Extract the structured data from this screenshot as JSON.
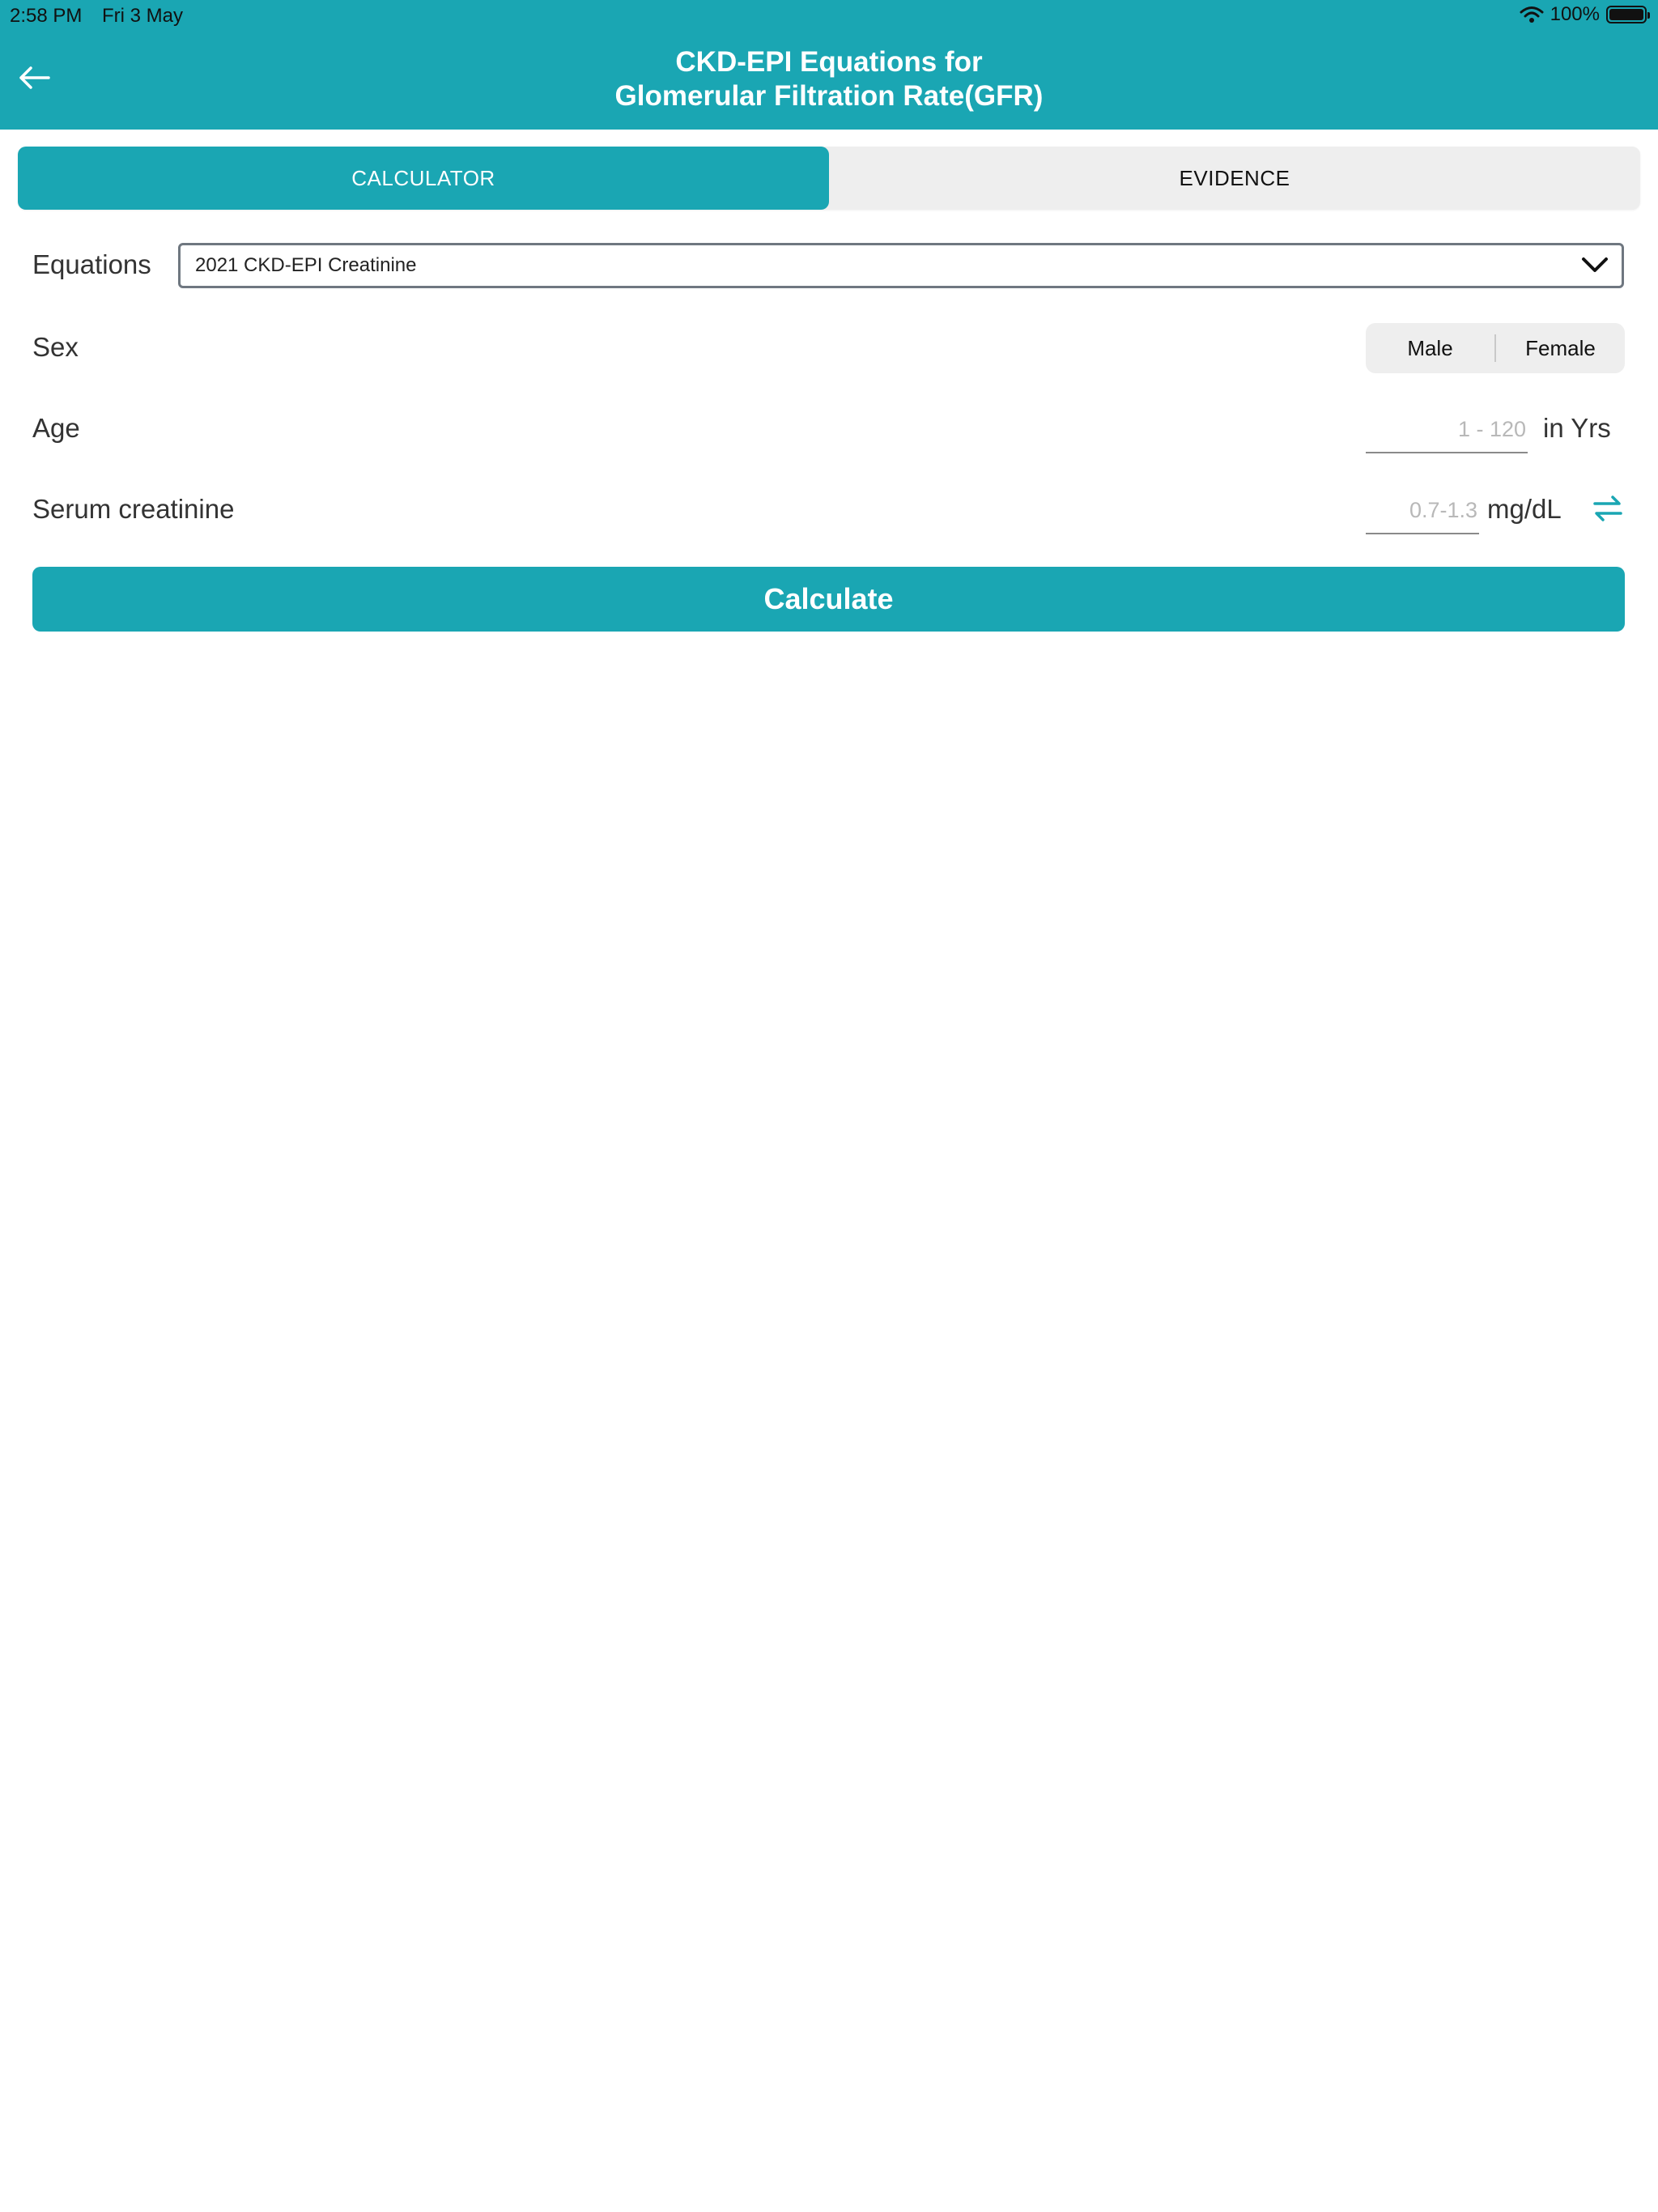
{
  "status_bar": {
    "time": "2:58 PM",
    "date": "Fri 3 May",
    "battery": "100%",
    "icons": [
      "wifi-icon",
      "battery-icon"
    ]
  },
  "header": {
    "title_line1": "CKD-EPI Equations for",
    "title_line2": "Glomerular Filtration Rate(GFR)",
    "back_icon": "arrow-left-icon"
  },
  "tabs": [
    {
      "label": "CALCULATOR",
      "active": true
    },
    {
      "label": "EVIDENCE",
      "active": false
    }
  ],
  "form": {
    "equations": {
      "label": "Equations",
      "selected": "2021 CKD-EPI Creatinine",
      "icon": "chevron-down-icon"
    },
    "sex": {
      "label": "Sex",
      "options": [
        "Male",
        "Female"
      ]
    },
    "age": {
      "label": "Age",
      "placeholder": "1 - 120",
      "unit": "in Yrs"
    },
    "creatinine": {
      "label": "Serum creatinine",
      "placeholder": "0.7-1.3",
      "unit": "mg/dL",
      "swap_icon": "swap-units-icon"
    },
    "calculate_label": "Calculate"
  },
  "colors": {
    "accent": "#1aa6b3",
    "tab_inactive_bg": "#eeeeee",
    "text": "#333333"
  }
}
